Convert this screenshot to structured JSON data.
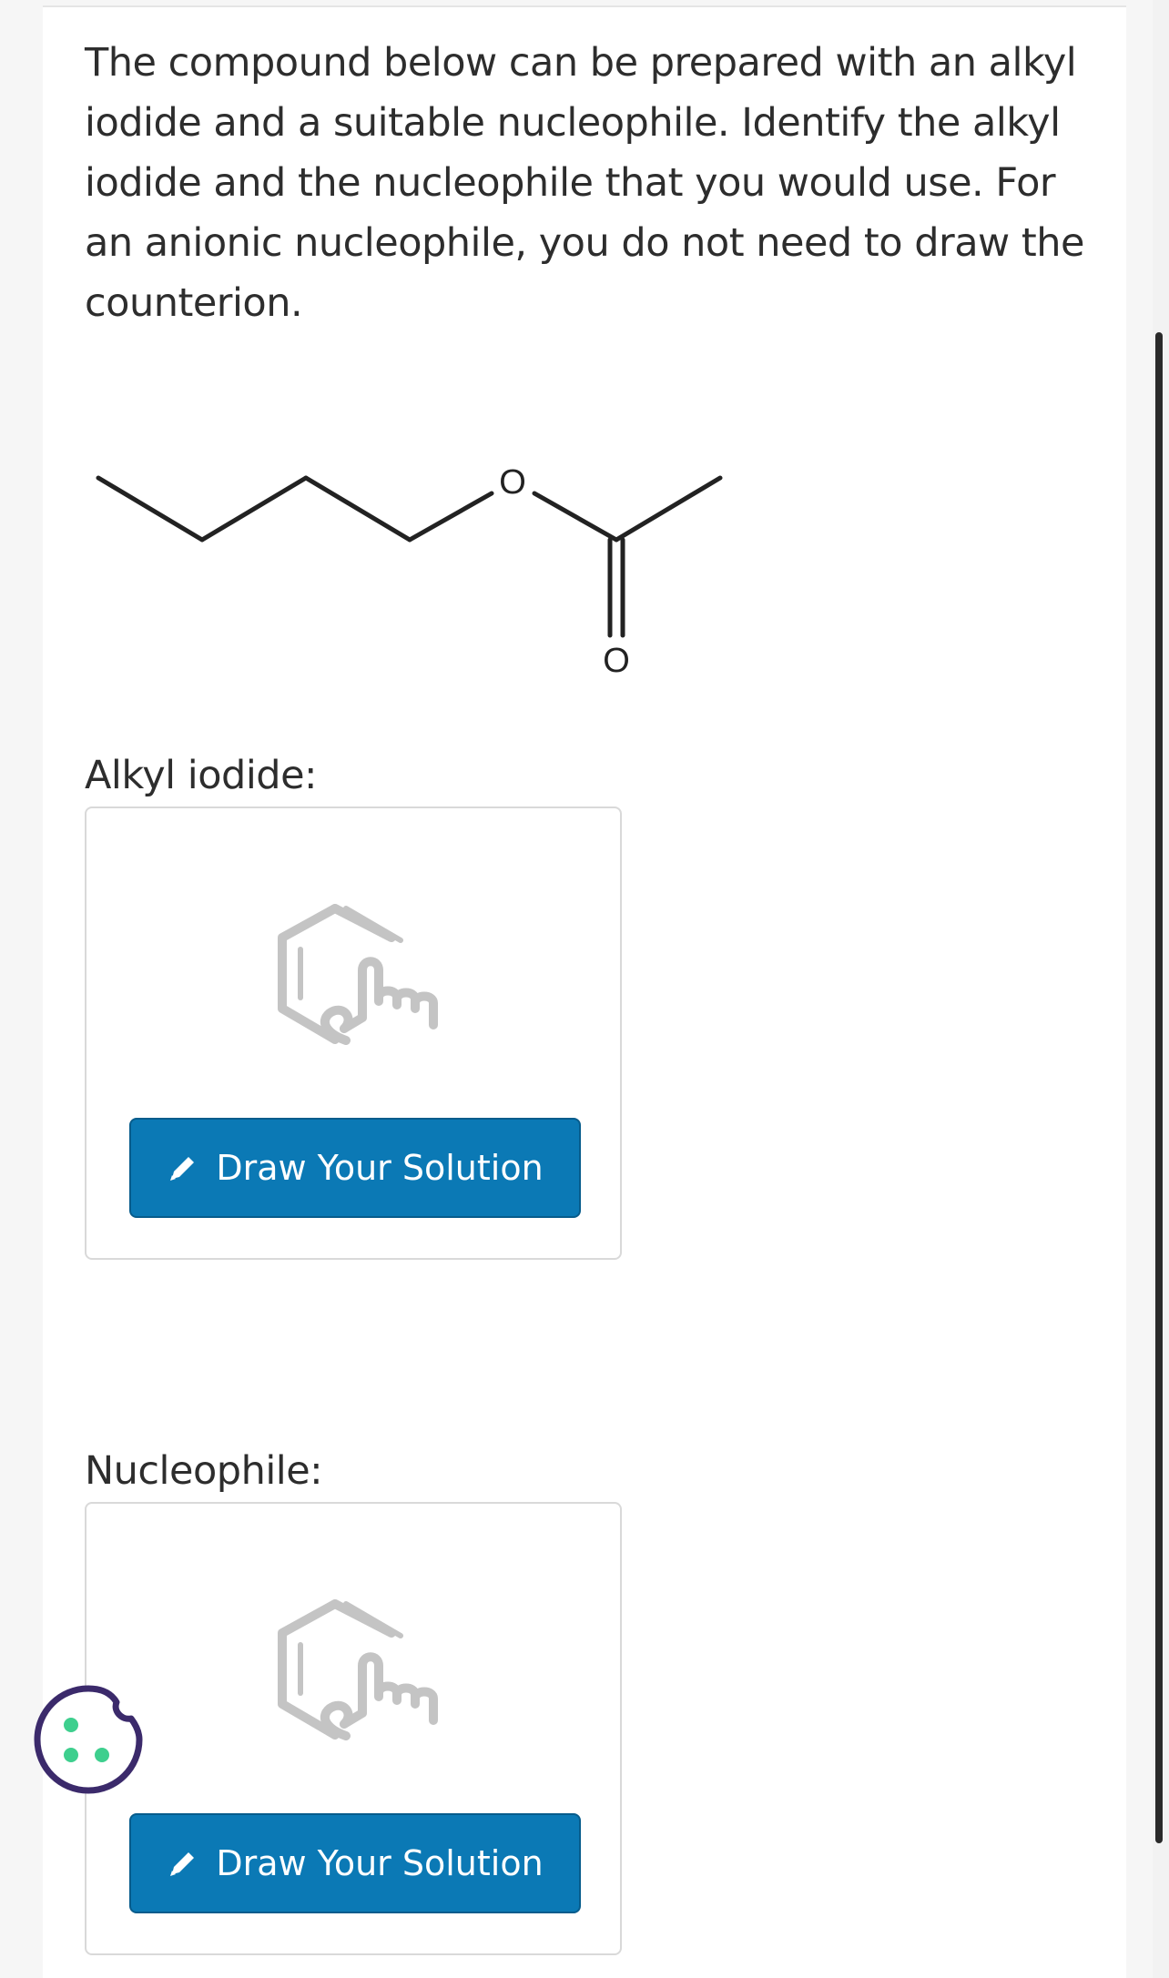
{
  "question": {
    "text": "The compound below can be prepared with an alkyl iodide and a suitable nucleophile. Identify the alkyl iodide and the nucleophile that you would use. For an anionic nucleophile, you do not need to draw the counterion."
  },
  "molecule": {
    "ether_oxygen_label": "O",
    "carbonyl_oxygen_label": "O"
  },
  "sections": [
    {
      "label": "Alkyl iodide:",
      "button_label": "Draw Your Solution",
      "button_icon": "pencil-icon",
      "placeholder_icon": "draw-structure-icon"
    },
    {
      "label": "Nucleophile:",
      "button_label": "Draw Your Solution",
      "button_icon": "pencil-icon",
      "placeholder_icon": "draw-structure-icon"
    }
  ],
  "cookie": {
    "icon": "cookie-icon"
  },
  "colors": {
    "button_bg": "#0b79b5",
    "text": "#2d2d2d",
    "icon_gray": "#c4c4c4",
    "cookie_outline": "#3b2a6b",
    "cookie_dots": "#3ecf8e"
  }
}
